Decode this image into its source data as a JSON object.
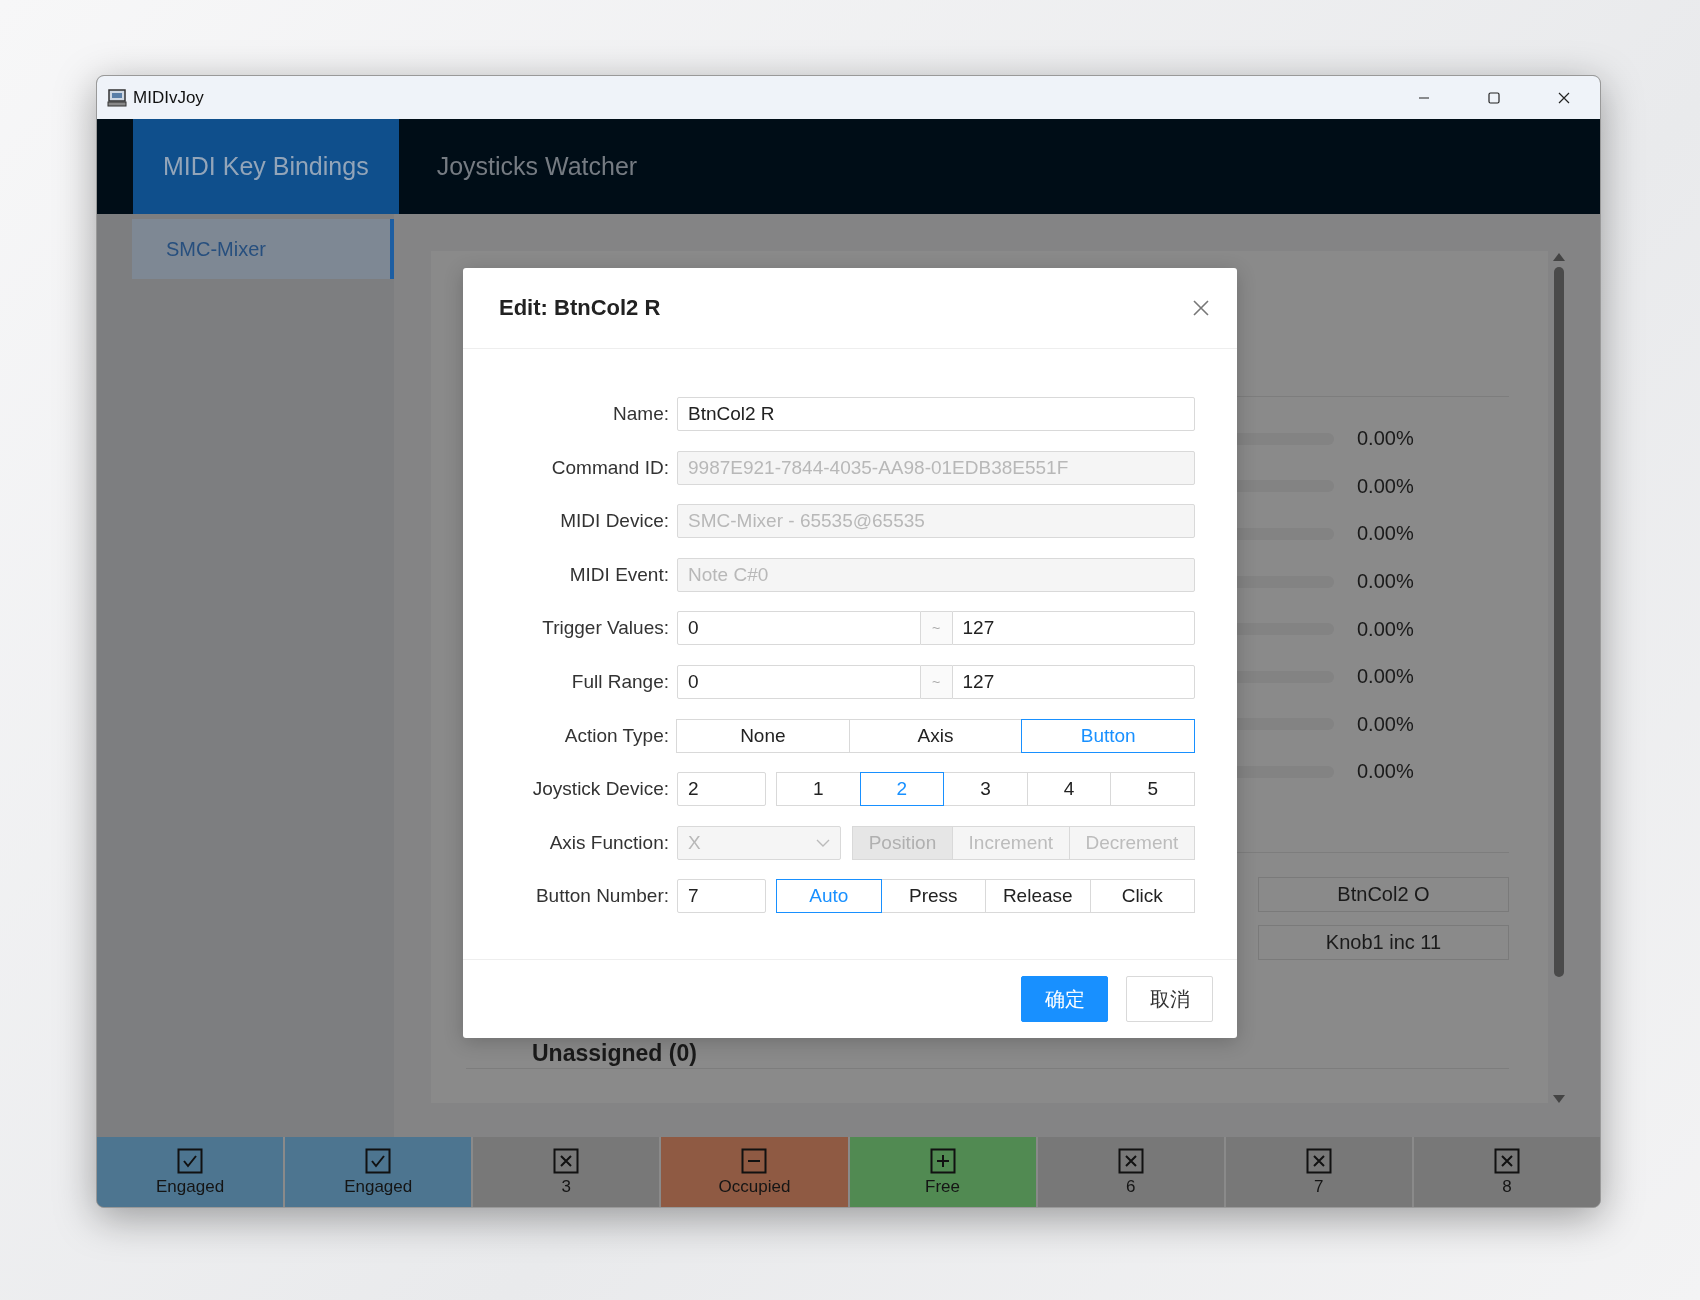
{
  "window": {
    "title": "MIDIvJoy"
  },
  "tabs": [
    {
      "label": "MIDI Key Bindings",
      "selected": true
    },
    {
      "label": "Joysticks Watcher",
      "selected": false
    }
  ],
  "sidebar": {
    "items": [
      {
        "label": "SMC-Mixer",
        "selected": true
      }
    ]
  },
  "panel": {
    "meters": [
      {
        "level": 0,
        "reading": "0.00%"
      },
      {
        "level": 0,
        "reading": "0.00%"
      },
      {
        "level": 0,
        "reading": "0.00%"
      },
      {
        "level": 0,
        "reading": "0.00%"
      },
      {
        "level": 0,
        "reading": "0.00%"
      },
      {
        "level": 0,
        "reading": "0.00%"
      },
      {
        "level": 0,
        "reading": "0.00%"
      },
      {
        "level": 0,
        "reading": "0.00%"
      }
    ],
    "bindings": [
      "BtnCol2 O",
      "Knob1 inc 11"
    ],
    "section_title": "Unassigned (0)"
  },
  "dialog": {
    "title": "Edit: BtnCol2 R",
    "fields": [
      {
        "kind": "text",
        "label": "Name:",
        "value": "BtnCol2 R",
        "disabled": false
      },
      {
        "kind": "text",
        "label": "Command ID:",
        "value": "9987E921-7844-4035-AA98-01EDB38E551F",
        "disabled": true
      },
      {
        "kind": "text",
        "label": "MIDI Device:",
        "value": "SMC-Mixer - 65535@65535",
        "disabled": true
      },
      {
        "kind": "text",
        "label": "MIDI Event:",
        "value": "Note C#0",
        "disabled": true
      },
      {
        "kind": "range",
        "label": "Trigger Values:",
        "from": "0",
        "separator": "~",
        "to": "127"
      },
      {
        "kind": "range",
        "label": "Full Range:",
        "from": "0",
        "separator": "~",
        "to": "127"
      },
      {
        "kind": "segmented",
        "label": "Action Type:",
        "options": [
          {
            "label": "None",
            "selected": false
          },
          {
            "label": "Axis",
            "selected": false
          },
          {
            "label": "Button",
            "selected": true
          }
        ]
      },
      {
        "kind": "input_segmented",
        "label": "Joystick Device:",
        "value": "2",
        "options": [
          {
            "label": "1",
            "selected": false
          },
          {
            "label": "2",
            "selected": true
          },
          {
            "label": "3",
            "selected": false
          },
          {
            "label": "4",
            "selected": false
          },
          {
            "label": "5",
            "selected": false
          }
        ]
      },
      {
        "kind": "select_segmented",
        "label": "Axis Function:",
        "value": "X",
        "disabled": true,
        "options": [
          {
            "label": "Position",
            "selected": true
          },
          {
            "label": "Increment",
            "selected": false
          },
          {
            "label": "Decrement",
            "selected": false
          }
        ]
      },
      {
        "kind": "input_segmented",
        "label": "Button Number:",
        "value": "7",
        "options": [
          {
            "label": "Auto",
            "selected": true
          },
          {
            "label": "Press",
            "selected": false
          },
          {
            "label": "Release",
            "selected": false
          },
          {
            "label": "Click",
            "selected": false
          }
        ]
      }
    ],
    "buttons": [
      {
        "kind": "primary",
        "label": "确定"
      },
      {
        "kind": "default",
        "label": "取消"
      }
    ]
  },
  "status_bar": [
    {
      "label": "Engaged",
      "kind": "engaged",
      "color": "#4d7590"
    },
    {
      "label": "Engaged",
      "kind": "engaged",
      "color": "#4d7590"
    },
    {
      "label": "3",
      "kind": "unavailable",
      "color": "#787878"
    },
    {
      "label": "Occupied",
      "kind": "occupied",
      "color": "#8f5a43"
    },
    {
      "label": "Free",
      "kind": "free",
      "color": "#518a52"
    },
    {
      "label": "6",
      "kind": "unavailable",
      "color": "#787878"
    },
    {
      "label": "7",
      "kind": "unavailable",
      "color": "#787878"
    },
    {
      "label": "8",
      "kind": "unavailable",
      "color": "#787878"
    }
  ]
}
